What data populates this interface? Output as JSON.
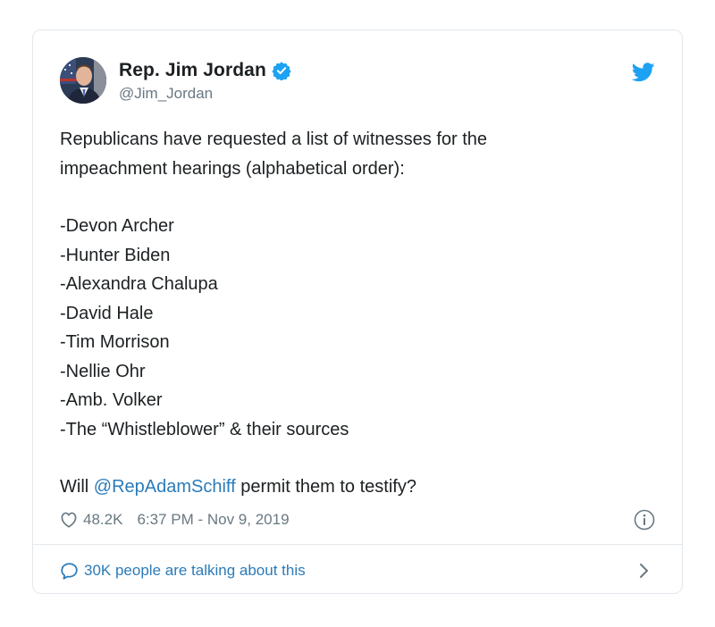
{
  "tweet": {
    "author": {
      "display_name": "Rep. Jim Jordan",
      "handle": "@Jim_Jordan",
      "verified": true
    },
    "intro_lines": [
      "Republicans have requested a list of witnesses for the",
      "impeachment hearings (alphabetical order):"
    ],
    "witnesses": [
      "-Devon Archer",
      "-Hunter Biden",
      "-Alexandra Chalupa",
      "-David Hale",
      "-Tim Morrison",
      "-Nellie Ohr",
      "-Amb. Volker",
      "-The “Whistleblower” & their sources"
    ],
    "closing": {
      "prefix": "Will ",
      "mention": "@RepAdamSchiff",
      "suffix": " permit them to testify?"
    },
    "likes": "48.2K",
    "timestamp": "6:37 PM - Nov 9, 2019",
    "conversation": "30K people are talking about this"
  },
  "colors": {
    "link": "#2b7bb9",
    "muted": "#697882",
    "twitter_blue": "#1da1f2",
    "border": "#e1e8ed"
  },
  "icons": [
    "verified-badge-icon",
    "twitter-bird-icon",
    "heart-icon",
    "info-icon",
    "speech-bubble-icon",
    "chevron-right-icon"
  ]
}
